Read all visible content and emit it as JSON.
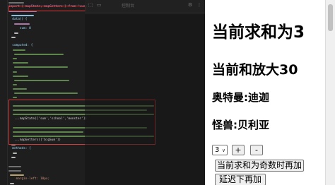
{
  "editor": {
    "import_line": "import { mapState, mapGetters } from 'vuex'",
    "data_line": "data() {",
    "sum_line": "sum: 0",
    "computed_line": "computed: {",
    "map_state_line": "...mapState(['sum','school','monster'])",
    "map_getters_line": "...mapGetters(['bigSum'])",
    "methods_line": "methods: {",
    "style_line": "margin-left: 10px;"
  },
  "browser_overlay": {
    "tab_label": "控制台"
  },
  "app": {
    "sum_heading": "当前求和为3",
    "big_heading": "当前和放大30",
    "ultraman": "奥特曼:迪迦",
    "monster": "怪兽:贝利亚",
    "select_value": "3",
    "plus_label": "+",
    "minus_label": "-",
    "odd_button": "当前求和为奇数时再加",
    "wait_button": "延迟下再加"
  }
}
